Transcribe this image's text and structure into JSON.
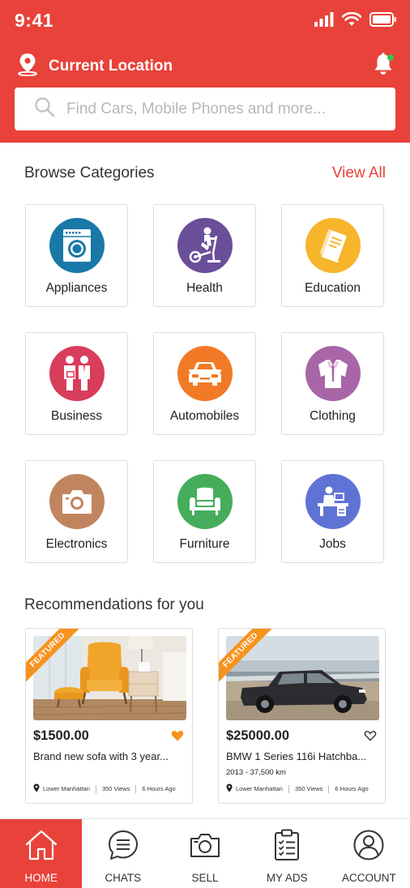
{
  "status_bar": {
    "time": "9:41"
  },
  "header": {
    "location_label": "Current Location",
    "search_placeholder": "Find Cars, Mobile Phones and more..."
  },
  "categories_section": {
    "title": "Browse Categories",
    "view_all_label": "View All",
    "items": [
      {
        "label": "Appliances",
        "icon": "washing-machine-icon",
        "color": "#1a78a8"
      },
      {
        "label": "Health",
        "icon": "exercise-bike-icon",
        "color": "#6b4e9a"
      },
      {
        "label": "Education",
        "icon": "book-icon",
        "color": "#f7b52b"
      },
      {
        "label": "Business",
        "icon": "business-people-icon",
        "color": "#d93d5c"
      },
      {
        "label": "Automobiles",
        "icon": "car-icon",
        "color": "#f27a26"
      },
      {
        "label": "Clothing",
        "icon": "suit-icon",
        "color": "#a865a8"
      },
      {
        "label": "Electronics",
        "icon": "camera-icon",
        "color": "#c0855e"
      },
      {
        "label": "Furniture",
        "icon": "armchair-icon",
        "color": "#45ad5c"
      },
      {
        "label": "Jobs",
        "icon": "desk-worker-icon",
        "color": "#5f73d4"
      }
    ]
  },
  "recommendations": {
    "title": "Recommendations for you",
    "items": [
      {
        "badge": "FEATURED",
        "price": "$1500.00",
        "title": "Brand new sofa with 3 year...",
        "subtitle": "",
        "location": "Lower Manhattan",
        "views": "350 Views",
        "posted": "6 Hours Ago",
        "favorited": true
      },
      {
        "badge": "FEATURED",
        "price": "$25000.00",
        "title": "BMW 1 Series 116i Hatchba...",
        "subtitle": "2013 - 37,500 km",
        "location": "Lower Manhattan",
        "views": "350 Views",
        "posted": "6 Hours Ago",
        "favorited": false
      }
    ]
  },
  "tabbar": {
    "active": "HOME",
    "tabs": [
      {
        "label": "HOME",
        "icon": "home-icon"
      },
      {
        "label": "CHATS",
        "icon": "chat-icon"
      },
      {
        "label": "SELL",
        "icon": "camera-icon"
      },
      {
        "label": "MY ADS",
        "icon": "clipboard-icon"
      },
      {
        "label": "ACCOUNT",
        "icon": "user-icon"
      }
    ]
  },
  "colors": {
    "brand": "#e8423a",
    "featured": "#f6921e",
    "notification_dot": "#3cc14f"
  }
}
